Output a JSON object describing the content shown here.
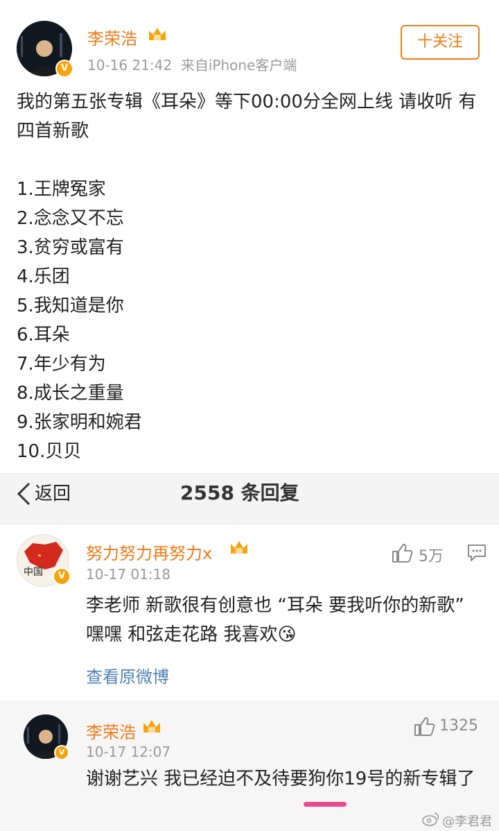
{
  "post": {
    "author": "李荣浩",
    "meta": "10-16 21:42  来自iPhone客户端",
    "follow_label": "十关注",
    "text": "我的第五张专辑《耳朵》等下00:00分全网上线 请收听 有四首新歌",
    "tracks": [
      "1.王牌冤家",
      "2.念念又不忘",
      "3.贫穷或富有",
      "4.乐团",
      "5.我知道是你",
      "6.耳朵",
      "7.年少有为",
      "8.成长之重量",
      "9.张家明和婉君",
      "10.贝贝"
    ]
  },
  "header": {
    "back_label": "返回",
    "reply_count": "2558 条回复"
  },
  "comment": {
    "author": "努力努力再努力x",
    "time": "10-17 01:18",
    "likes": "5万",
    "text": "李老师 新歌很有创意也 “耳朵 要我听你的新歌” 嘿嘿 和弦走花路 我喜欢😘",
    "view_original": "查看原微博",
    "avatar_text": "中国"
  },
  "reply": {
    "author": "李荣浩",
    "time": "10-17 12:07",
    "likes": "1325",
    "text": "谢谢艺兴 我已经迫不及待要狗你19号的新专辑了"
  },
  "watermark": "@李君君",
  "colors": {
    "accent": "#f07a16",
    "badge": "#f6a40c",
    "link": "#4e82b6",
    "underline": "#e84a8f"
  }
}
